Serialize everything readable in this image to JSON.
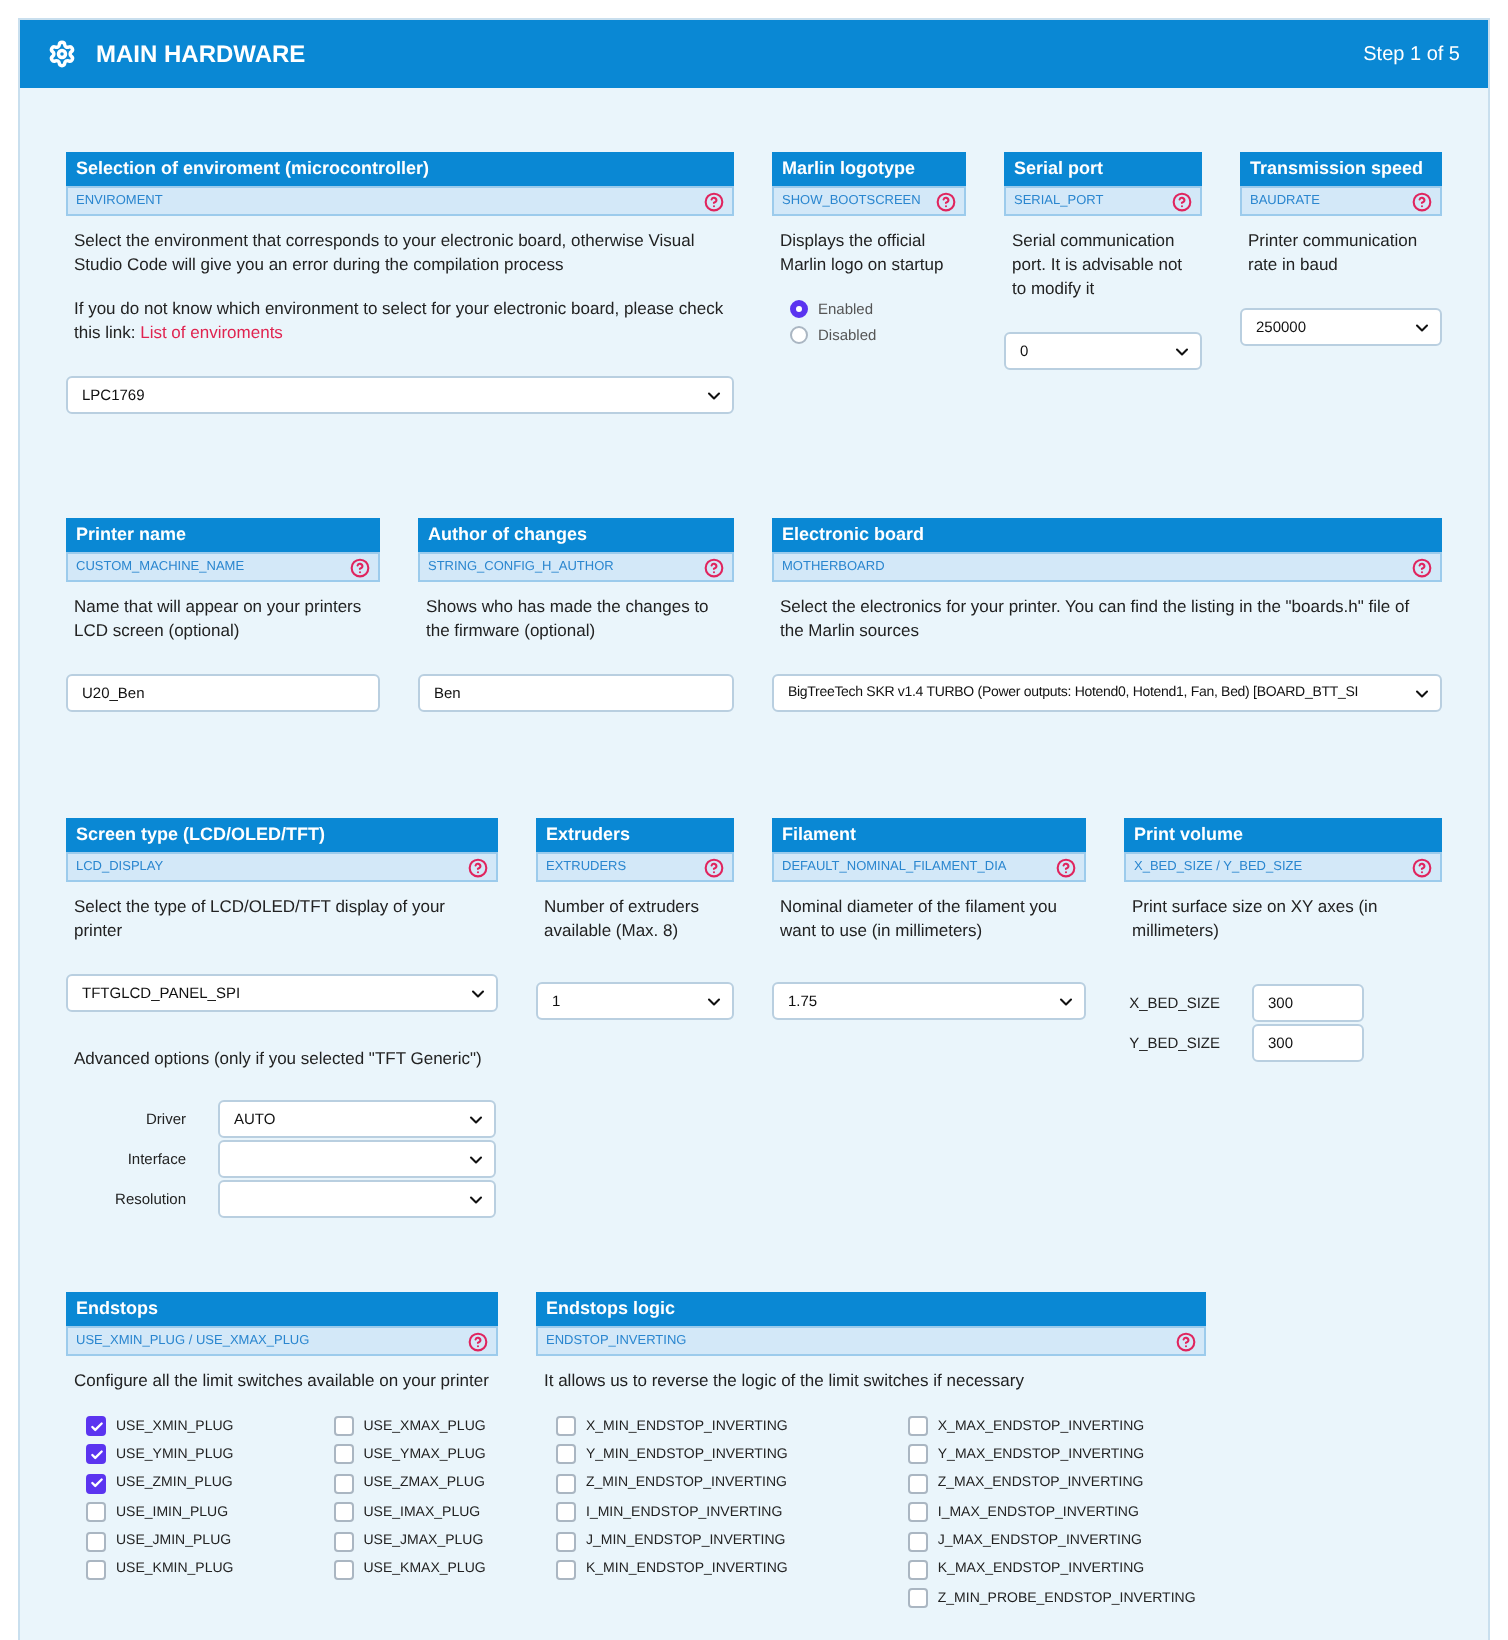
{
  "header": {
    "title": "MAIN HARDWARE",
    "step": "Step 1 of 5"
  },
  "rows": [
    [
      {
        "title": "Selection of enviroment (microcontroller)",
        "define": "ENVIROMENT",
        "paragraphs": [
          {
            "text": "Select the environment that corresponds to your electronic board, otherwise Visual Studio Code will give you an error during the compilation process"
          },
          {
            "text": "If you do not know which environment to select for your electronic board, please check this link:",
            "link": "List of enviroments"
          }
        ],
        "controls": [
          {
            "kind": "select",
            "value": "LPC1769"
          }
        ]
      },
      {
        "title": "Marlin logotype",
        "define": "SHOW_BOOTSCREEN",
        "paragraphs": [
          {
            "text": "Displays the official Marlin logo on startup"
          }
        ],
        "controls": [
          {
            "kind": "radio",
            "options": [
              {
                "label": "Enabled",
                "selected": true
              },
              {
                "label": "Disabled",
                "selected": false
              }
            ]
          }
        ]
      },
      {
        "title": "Serial port",
        "define": "SERIAL_PORT",
        "paragraphs": [
          {
            "text": "Serial communication port. It is advisable not to modify it"
          }
        ],
        "controls": [
          {
            "kind": "select",
            "value": "0"
          }
        ]
      },
      {
        "title": "Transmission speed",
        "define": "BAUDRATE",
        "paragraphs": [
          {
            "text": "Printer communication rate in baud"
          }
        ],
        "controls": [
          {
            "kind": "select",
            "value": "250000"
          }
        ]
      }
    ],
    [
      {
        "title": "Printer name",
        "define": "CUSTOM_MACHINE_NAME",
        "paragraphs": [
          {
            "text": "Name that will appear on your printers LCD screen (optional)"
          }
        ],
        "controls": [
          {
            "kind": "text",
            "value": "U20_Ben"
          }
        ]
      },
      {
        "title": "Author of changes",
        "define": "STRING_CONFIG_H_AUTHOR",
        "paragraphs": [
          {
            "text": "Shows who has made the changes to the firmware (optional)"
          }
        ],
        "controls": [
          {
            "kind": "text",
            "value": "Ben"
          }
        ]
      },
      {
        "title": "Electronic board",
        "define": "MOTHERBOARD",
        "paragraphs": [
          {
            "text": "Select the electronics for your printer. You can find the listing in the \"boards.h\" file of the Marlin sources"
          }
        ],
        "controls": [
          {
            "kind": "select",
            "value": "BigTreeTech SKR v1.4 TURBO (Power outputs: Hotend0, Hotend1, Fan, Bed) [BOARD_BTT_SI"
          }
        ]
      }
    ],
    [
      {
        "title": "Screen type (LCD/OLED/TFT)",
        "define": "LCD_DISPLAY",
        "paragraphs": [
          {
            "text": "Select the type of LCD/OLED/TFT display of your printer"
          }
        ],
        "controls": [
          {
            "kind": "select",
            "value": "TFTGLCD_PANEL_SPI"
          },
          {
            "kind": "note",
            "text": "Advanced options (only if you selected \"TFT Generic\")"
          },
          {
            "kind": "labeled_select",
            "label": "Driver",
            "value": "AUTO"
          },
          {
            "kind": "labeled_select",
            "label": "Interface"
          },
          {
            "kind": "labeled_select",
            "label": "Resolution"
          }
        ]
      },
      {
        "title": "Extruders",
        "define": "EXTRUDERS",
        "paragraphs": [
          {
            "text": "Number of extruders available (Max. 8)"
          }
        ],
        "controls": [
          {
            "kind": "select",
            "value": "1"
          }
        ]
      },
      {
        "title": "Filament",
        "define": "DEFAULT_NOMINAL_FILAMENT_DIA",
        "paragraphs": [
          {
            "text": "Nominal diameter of the filament you want to use (in millimeters)"
          }
        ],
        "controls": [
          {
            "kind": "select",
            "value": "1.75"
          }
        ]
      },
      {
        "title": "Print volume",
        "define": "X_BED_SIZE / Y_BED_SIZE",
        "paragraphs": [
          {
            "text": "Print surface size on XY axes (in millimeters)"
          }
        ],
        "controls": [
          {
            "kind": "labeled_text",
            "label": "X_BED_SIZE",
            "value": "300"
          },
          {
            "kind": "labeled_text",
            "label": "Y_BED_SIZE",
            "value": "300"
          }
        ]
      }
    ],
    [
      {
        "title": "Endstops",
        "define": "USE_XMIN_PLUG / USE_XMAX_PLUG",
        "paragraphs": [
          {
            "text": "Configure all the limit switches available on your printer"
          }
        ],
        "controls": [
          {
            "kind": "checkboxes",
            "columns": [
              [
                {
                  "label": "USE_XMIN_PLUG",
                  "checked": true
                },
                {
                  "label": "USE_YMIN_PLUG",
                  "checked": true
                },
                {
                  "label": "USE_ZMIN_PLUG",
                  "checked": true
                },
                {
                  "label": "USE_IMIN_PLUG",
                  "checked": false
                },
                {
                  "label": "USE_JMIN_PLUG",
                  "checked": false
                },
                {
                  "label": "USE_KMIN_PLUG",
                  "checked": false
                }
              ],
              [
                {
                  "label": "USE_XMAX_PLUG",
                  "checked": false
                },
                {
                  "label": "USE_YMAX_PLUG",
                  "checked": false
                },
                {
                  "label": "USE_ZMAX_PLUG",
                  "checked": false
                },
                {
                  "label": "USE_IMAX_PLUG",
                  "checked": false
                },
                {
                  "label": "USE_JMAX_PLUG",
                  "checked": false
                },
                {
                  "label": "USE_KMAX_PLUG",
                  "checked": false
                }
              ]
            ]
          }
        ]
      },
      {
        "title": "Endstops logic",
        "define": "ENDSTOP_INVERTING",
        "paragraphs": [
          {
            "text": "It allows us to reverse the logic of the limit switches if necessary"
          }
        ],
        "controls": [
          {
            "kind": "checkboxes",
            "columns": [
              [
                {
                  "label": "X_MIN_ENDSTOP_INVERTING",
                  "checked": false
                },
                {
                  "label": "Y_MIN_ENDSTOP_INVERTING",
                  "checked": false
                },
                {
                  "label": "Z_MIN_ENDSTOP_INVERTING",
                  "checked": false
                },
                {
                  "label": "I_MIN_ENDSTOP_INVERTING",
                  "checked": false
                },
                {
                  "label": "J_MIN_ENDSTOP_INVERTING",
                  "checked": false
                },
                {
                  "label": "K_MIN_ENDSTOP_INVERTING",
                  "checked": false
                }
              ],
              [
                {
                  "label": "X_MAX_ENDSTOP_INVERTING",
                  "checked": false
                },
                {
                  "label": "Y_MAX_ENDSTOP_INVERTING",
                  "checked": false
                },
                {
                  "label": "Z_MAX_ENDSTOP_INVERTING",
                  "checked": false
                },
                {
                  "label": "I_MAX_ENDSTOP_INVERTING",
                  "checked": false
                },
                {
                  "label": "J_MAX_ENDSTOP_INVERTING",
                  "checked": false
                },
                {
                  "label": "K_MAX_ENDSTOP_INVERTING",
                  "checked": false
                },
                {
                  "label": "Z_MIN_PROBE_ENDSTOP_INVERTING",
                  "checked": false
                }
              ]
            ]
          }
        ]
      }
    ]
  ]
}
